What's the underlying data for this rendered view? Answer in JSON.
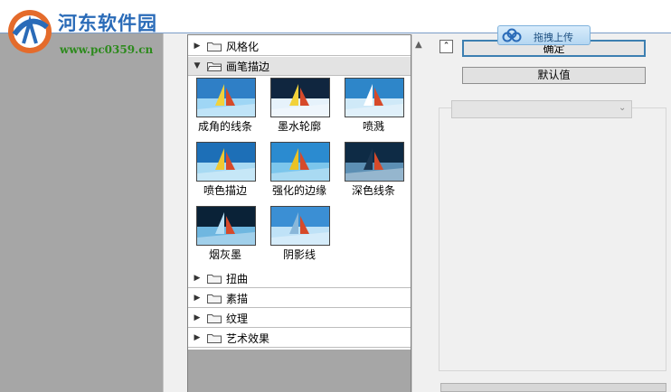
{
  "watermark": {
    "site_name": "河东软件园",
    "site_url": "www.pc0359.cn"
  },
  "filter_gallery": {
    "categories_top": [
      {
        "label": "风格化",
        "expanded": false
      },
      {
        "label": "画笔描边",
        "expanded": true
      }
    ],
    "thumbnails": [
      {
        "caption": "成角的线条",
        "icon": "angled-strokes-thumbnail"
      },
      {
        "caption": "墨水轮廓",
        "icon": "ink-outlines-thumbnail"
      },
      {
        "caption": "喷溅",
        "icon": "spatter-thumbnail"
      },
      {
        "caption": "喷色描边",
        "icon": "sprayed-strokes-thumbnail"
      },
      {
        "caption": "强化的边缘",
        "icon": "accented-edges-thumbnail"
      },
      {
        "caption": "深色线条",
        "icon": "dark-strokes-thumbnail"
      },
      {
        "caption": "烟灰墨",
        "icon": "sumi-e-thumbnail"
      },
      {
        "caption": "阴影线",
        "icon": "crosshatch-thumbnail"
      }
    ],
    "categories_bottom": [
      {
        "label": "扭曲",
        "expanded": false
      },
      {
        "label": "素描",
        "expanded": false
      },
      {
        "label": "纹理",
        "expanded": false
      },
      {
        "label": "艺术效果",
        "expanded": false
      }
    ]
  },
  "controls": {
    "ok_label": "确定",
    "default_label": "默认值",
    "upload_label": "拖拽上传",
    "filter_select_value": ""
  },
  "colors": {
    "preview_bg": "#a6a6a6",
    "accent": "#3c7fb1",
    "watermark_blue": "#2a6bb8",
    "watermark_green": "#2d8a1d"
  }
}
